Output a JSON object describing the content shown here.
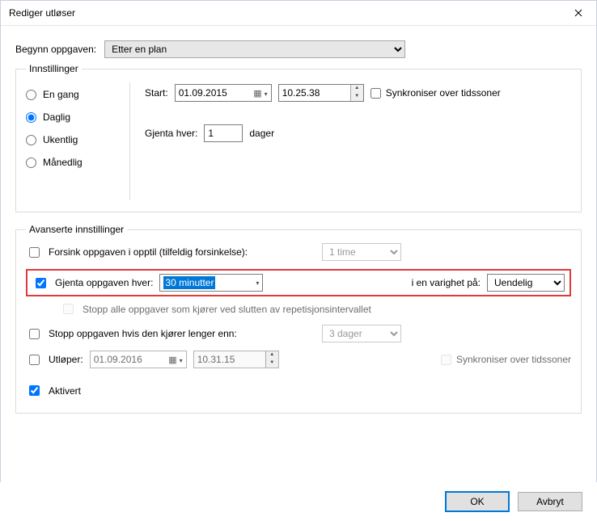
{
  "window": {
    "title": "Rediger utløser"
  },
  "begin": {
    "label": "Begynn oppgaven:",
    "value": "Etter en plan"
  },
  "settings": {
    "legend": "Innstillinger",
    "recurrence": {
      "once": "En gang",
      "daily": "Daglig",
      "weekly": "Ukentlig",
      "monthly": "Månedlig",
      "selected": "daily"
    },
    "start": {
      "label": "Start:",
      "date": "01.09.2015",
      "time": "10.25.38",
      "sync_label": "Synkroniser over tidssoner",
      "sync_checked": false
    },
    "repeat_every": {
      "label": "Gjenta hver:",
      "value": "1",
      "unit": "dager"
    }
  },
  "advanced": {
    "legend": "Avanserte innstillinger",
    "delay": {
      "checked": false,
      "label": "Forsink oppgaven i opptil (tilfeldig forsinkelse):",
      "value": "1 time"
    },
    "repeat_task": {
      "checked": true,
      "label": "Gjenta oppgaven hver:",
      "value": "30 minutter",
      "duration_label": "i en varighet på:",
      "duration_value": "Uendelig"
    },
    "stop_at_end": {
      "checked": false,
      "label": "Stopp alle oppgaver som kjører ved slutten av repetisjonsintervallet"
    },
    "stop_if_longer": {
      "checked": false,
      "label": "Stopp oppgaven hvis den kjører lenger enn:",
      "value": "3 dager"
    },
    "expires": {
      "checked": false,
      "label": "Utløper:",
      "date": "01.09.2016",
      "time": "10.31.15",
      "sync_label": "Synkroniser over tidssoner"
    },
    "enabled": {
      "checked": true,
      "label": "Aktivert"
    }
  },
  "buttons": {
    "ok": "OK",
    "cancel": "Avbryt"
  }
}
